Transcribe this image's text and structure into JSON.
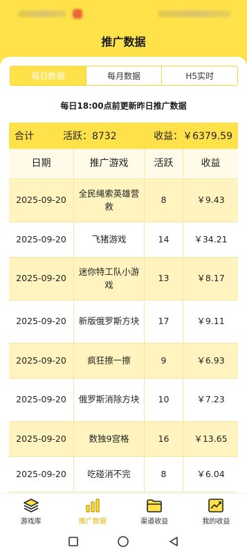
{
  "page_title": "推广数据",
  "tabs": [
    {
      "label": "每日数据",
      "active": true
    },
    {
      "label": "每月数据",
      "active": false
    },
    {
      "label": "H5实时",
      "active": false
    }
  ],
  "notice": "每日18:00点前更新昨日推广数据",
  "summary": {
    "total_label": "合计",
    "active_text": "活跃：8732",
    "revenue_text": "收益：￥6379.59"
  },
  "table": {
    "headers": [
      "日期",
      "推广游戏",
      "活跃",
      "收益"
    ],
    "rows": [
      {
        "date": "2025-09-20",
        "game": "全民绳索英雄营救",
        "active": "8",
        "revenue": "￥9.43"
      },
      {
        "date": "2025-09-20",
        "game": "飞猪游戏",
        "active": "14",
        "revenue": "￥34.21"
      },
      {
        "date": "2025-09-20",
        "game": "迷你特工队小游戏",
        "active": "13",
        "revenue": "￥8.17"
      },
      {
        "date": "2025-09-20",
        "game": "新版俄罗斯方块",
        "active": "17",
        "revenue": "￥9.11"
      },
      {
        "date": "2025-09-20",
        "game": "疯狂擦一擦",
        "active": "9",
        "revenue": "￥6.93"
      },
      {
        "date": "2025-09-20",
        "game": "俄罗斯消除方块",
        "active": "10",
        "revenue": "￥7.23"
      },
      {
        "date": "2025-09-20",
        "game": "数独9宫格",
        "active": "16",
        "revenue": "￥13.65"
      },
      {
        "date": "2025-09-20",
        "game": "吃碰消不完",
        "active": "8",
        "revenue": "￥6.04"
      }
    ]
  },
  "bottom_nav": [
    {
      "label": "游戏库",
      "icon": "stack-icon",
      "active": false
    },
    {
      "label": "推广数据",
      "icon": "bar-chart-icon",
      "active": true
    },
    {
      "label": "渠道收益",
      "icon": "folder-icon",
      "active": false
    },
    {
      "label": "我的收益",
      "icon": "trend-chart-icon",
      "active": false
    }
  ],
  "colors": {
    "accent": "#FFE24A",
    "row_highlight": "#FFF4BF",
    "active_nav": "#E0B400"
  }
}
